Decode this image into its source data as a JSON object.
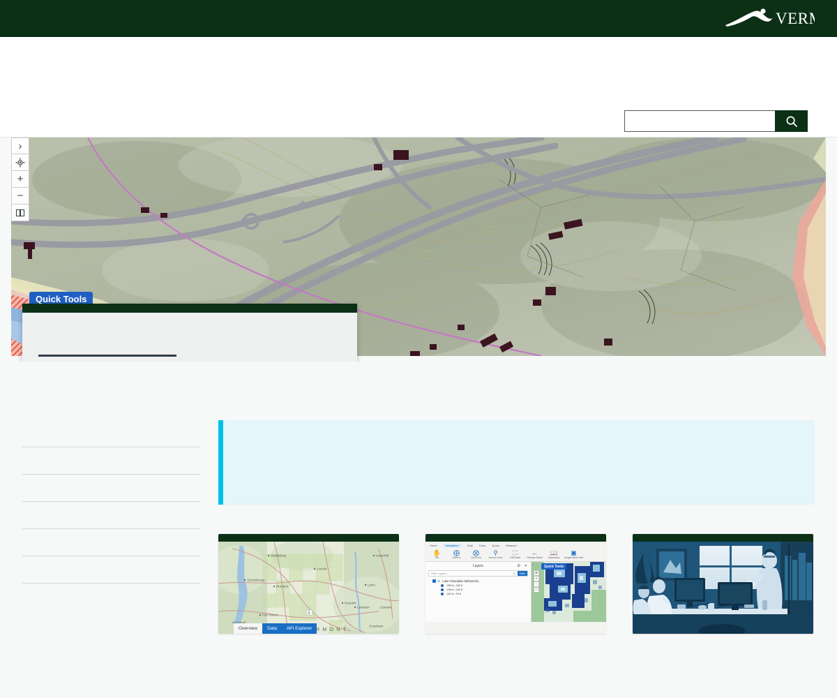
{
  "state_bar": {
    "logo_text": "VERMONT",
    "logo_icon": "vermont-mountain-swoosh-icon"
  },
  "header": {
    "search": {
      "value": "",
      "placeholder": "",
      "icon": "search-icon",
      "button_label": ""
    }
  },
  "hero_map": {
    "quick_tools_badge": "Quick Tools",
    "controls": [
      {
        "name": "expand-panel",
        "icon": "chevron-right-icon",
        "glyph": "›"
      },
      {
        "name": "locate",
        "icon": "crosshair-locate-icon",
        "glyph": "⊕"
      },
      {
        "name": "zoom-in",
        "icon": "plus-icon",
        "glyph": "+"
      },
      {
        "name": "zoom-out",
        "icon": "minus-icon",
        "glyph": "−"
      },
      {
        "name": "bookmarks",
        "icon": "bookmark-book-icon",
        "glyph": "□"
      }
    ]
  },
  "modal": {
    "title": "",
    "body_text": "",
    "cta_label": ""
  },
  "pill_buttons": [
    {
      "label": ""
    },
    {
      "label": ""
    },
    {
      "label": ""
    }
  ],
  "side_nav": {
    "items": [
      {
        "label": ""
      },
      {
        "label": ""
      },
      {
        "label": ""
      },
      {
        "label": ""
      },
      {
        "label": ""
      },
      {
        "label": ""
      }
    ]
  },
  "callout": {
    "text": "",
    "accent_color": "#00c0e8",
    "background_color": "#e4f5fb"
  },
  "cards": [
    {
      "name": "card-overview-map",
      "title": "",
      "thumb_type": "vermont-locator-map",
      "tabs": [
        {
          "label": "Overview",
          "state": "active"
        },
        {
          "label": "Data",
          "state": "on"
        },
        {
          "label": "API Explorer",
          "state": "on"
        }
      ],
      "place_labels": [
        "Middlebury",
        "Lincoln",
        "Haverhill",
        "Ticonderoga",
        "Brandon",
        "Lyme",
        "Norwich",
        "Lebanon",
        "Canaan",
        "Fair Haven",
        "Whitehall",
        "Grantham",
        "VERMONT"
      ],
      "route_markers": [
        "4"
      ]
    },
    {
      "name": "card-gis-application",
      "title": "",
      "thumb_type": "gis-application",
      "ribbon_tabs": [
        "Home",
        "Navigation",
        "Data",
        "Draw",
        "Query",
        "Measure"
      ],
      "ribbon_active": "Navigation",
      "toolbar": [
        {
          "label": "Pan",
          "icon": "hand-pan-icon",
          "glyph": "✋"
        },
        {
          "label": "Zoom In",
          "icon": "plus-circle-icon",
          "glyph": "⊕"
        },
        {
          "label": "Zoom Out",
          "icon": "minus-circle-icon",
          "glyph": "⊖"
        },
        {
          "label": "Zoom to Town",
          "icon": "magnifier-icon",
          "glyph": "⚲"
        },
        {
          "label": "Full Extent",
          "icon": "expand-arrows-icon",
          "glyph": "⛶"
        },
        {
          "label": "Previous Extent",
          "icon": "arrow-left-icon",
          "glyph": "←"
        },
        {
          "label": "Bookmarks",
          "icon": "book-icon",
          "glyph": "Ὅ6"
        },
        {
          "label": "Google Street View",
          "icon": "street-view-icon",
          "glyph": "▣"
        }
      ],
      "layers_panel": {
        "title": "Layers",
        "menu_icon": "hamburger-icon",
        "close_icon": "close-x-icon",
        "filter_placeholder": "Filter Layers...",
        "filter_clear_icon": "clear-circle-icon",
        "filter_button_label": "Filter",
        "layer_name": "Lake Champlain bathymetry",
        "layer_checked": true,
        "legend": [
          "-399 to -249 ft",
          "-248 to -162 ft",
          "-161 to -93 ft"
        ]
      },
      "map_quick_tools_badge": "Quick Tools",
      "map_controls": [
        {
          "icon": "crosshair-locate-icon",
          "glyph": "⊕"
        },
        {
          "icon": "plus-icon",
          "glyph": "+"
        },
        {
          "icon": "minus-icon",
          "glyph": "−"
        },
        {
          "icon": "bookmark-book-icon",
          "glyph": "□"
        }
      ]
    },
    {
      "name": "card-training-photo",
      "title": "",
      "thumb_type": "office-training-photo",
      "alt": "people working at computers in an office"
    }
  ],
  "colors": {
    "state_green": "#0b3016",
    "badge_blue": "#1f5fc4",
    "callout_cyan": "#00c0e8",
    "page_bg": "#f7f8f8",
    "modal_bg": "#eff0f0"
  }
}
